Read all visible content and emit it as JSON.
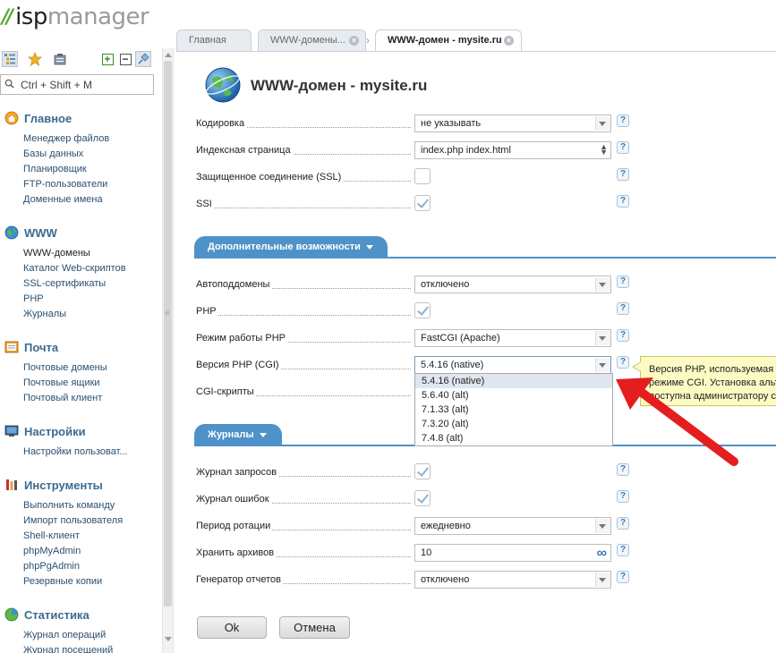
{
  "app": {
    "logo_main": "isp",
    "logo_sub": "manager"
  },
  "sidebar": {
    "search_placeholder": "Ctrl + Shift + M",
    "sections": [
      {
        "title": "Главное",
        "items": [
          "Менеджер файлов",
          "Базы данных",
          "Планировщик",
          "FTP-пользователи",
          "Доменные имена"
        ]
      },
      {
        "title": "WWW",
        "items": [
          "WWW-домены",
          "Каталог Web-скриптов",
          "SSL-сертификаты",
          "PHP",
          "Журналы"
        ]
      },
      {
        "title": "Почта",
        "items": [
          "Почтовые домены",
          "Почтовые ящики",
          "Почтовый клиент"
        ]
      },
      {
        "title": "Настройки",
        "items": [
          "Настройки пользоват..."
        ]
      },
      {
        "title": "Инструменты",
        "items": [
          "Выполнить команду",
          "Импорт пользователя",
          "Shell-клиент",
          "phpMyAdmin",
          "phpPgAdmin",
          "Резервные копии"
        ]
      },
      {
        "title": "Статистика",
        "items": [
          "Журнал операций",
          "Журнал посещений"
        ]
      }
    ]
  },
  "tabs": [
    "Главная",
    "WWW-домены...",
    "WWW-домен - mysite.ru"
  ],
  "form": {
    "title": "WWW-домен - mysite.ru",
    "fields": {
      "encoding": {
        "label": "Кодировка",
        "value": "не указывать"
      },
      "index_page": {
        "label": "Индексная страница",
        "value": "index.php index.html"
      },
      "ssl": {
        "label": "Защищенное соединение (SSL)",
        "checked": false
      },
      "ssi": {
        "label": "SSI",
        "checked": true
      }
    },
    "section_extra": "Дополнительные возможности",
    "extra": {
      "autosub": {
        "label": "Автоподдомены",
        "value": "отключено"
      },
      "php": {
        "label": "PHP",
        "checked": true
      },
      "php_mode": {
        "label": "Режим работы PHP",
        "value": "FastCGI (Apache)"
      },
      "php_version": {
        "label": "Версия PHP (CGI)",
        "value": "5.4.16 (native)"
      },
      "cgi": {
        "label": "CGI-скрипты"
      }
    },
    "php_version_options": [
      "5.4.16 (native)",
      "5.6.40 (alt)",
      "7.1.33 (alt)",
      "7.3.20 (alt)",
      "7.4.8 (alt)"
    ],
    "tooltip_lines": [
      "Версия PHP, используемая д",
      "режиме CGI. Установка альт",
      "доступна администратору се"
    ],
    "section_logs": "Журналы",
    "logs": {
      "access_log": {
        "label": "Журнал запросов",
        "checked": true
      },
      "error_log": {
        "label": "Журнал ошибок",
        "checked": true
      },
      "rotation": {
        "label": "Период ротации",
        "value": "ежедневно"
      },
      "keep": {
        "label": "Хранить архивов",
        "value": "10"
      },
      "report": {
        "label": "Генератор отчетов",
        "value": "отключено"
      }
    },
    "buttons": {
      "ok": "Ok",
      "cancel": "Отмена"
    }
  },
  "colors": {
    "section_blue": "#4e92c9",
    "arrow_red": "#e41e1e",
    "tooltip_bg": "#fdfbc4"
  }
}
